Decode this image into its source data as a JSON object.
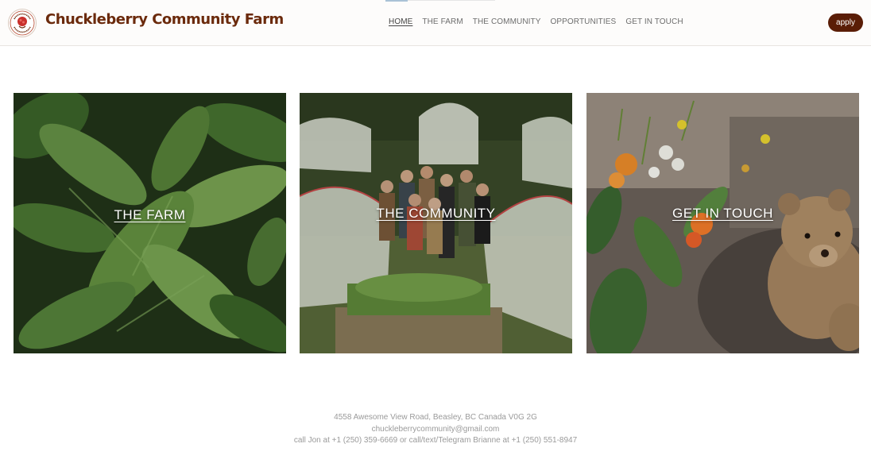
{
  "header": {
    "brand": "Chuckleberry Community Farm",
    "logo": "chuckleberry-logo",
    "nav": [
      {
        "label": "HOME",
        "active": true
      },
      {
        "label": "THE FARM",
        "active": false
      },
      {
        "label": "THE COMMUNITY",
        "active": false
      },
      {
        "label": "OPPORTUNITIES",
        "active": false
      },
      {
        "label": "GET IN TOUCH",
        "active": false
      }
    ],
    "apply_label": "apply",
    "accent_color": "#5a1d06"
  },
  "cards": [
    {
      "label": "THE FARM",
      "image": "basil-leaves-photo"
    },
    {
      "label": "THE COMMUNITY",
      "image": "garden-group-photo"
    },
    {
      "label": "GET IN TOUCH",
      "image": "teddy-bear-flowers-photo"
    }
  ],
  "footer": {
    "address": "4558 Awesome View Road, Beasley, BC Canada V0G 2G",
    "email": "chuckleberrycommunity@gmail.com",
    "phone": "call Jon at +1 (250) 359-6669 or call/text/Telegram Brianne at +1 (250) 551-8947"
  }
}
